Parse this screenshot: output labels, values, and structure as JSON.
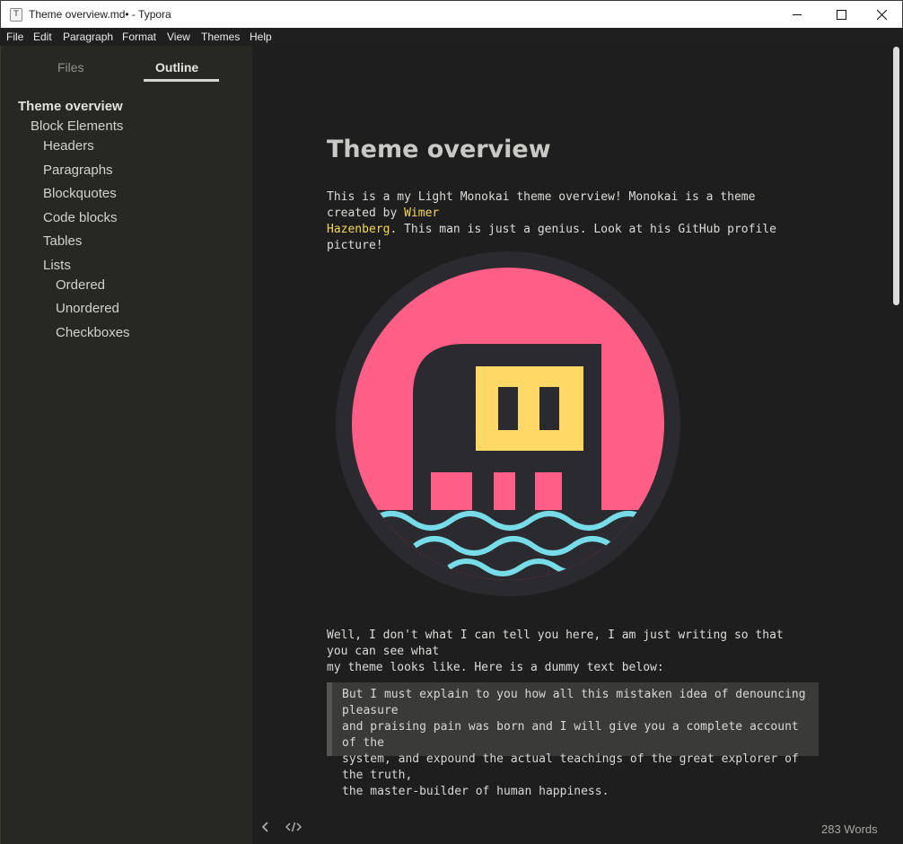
{
  "window": {
    "title": "Theme overview.md• - Typora",
    "app_icon_letter": "T"
  },
  "menu": {
    "items": [
      "File",
      "Edit",
      "Paragraph",
      "Format",
      "View",
      "Themes",
      "Help"
    ]
  },
  "sidebar": {
    "tabs": [
      {
        "label": "Files",
        "active": false
      },
      {
        "label": "Outline",
        "active": true
      }
    ],
    "outline": [
      {
        "label": "Theme overview",
        "level": 1
      },
      {
        "label": "Block Elements",
        "level": 2
      },
      {
        "label": "Headers",
        "level": 3
      },
      {
        "label": "Paragraphs",
        "level": 3
      },
      {
        "label": "Blockquotes",
        "level": 3
      },
      {
        "label": "Code blocks",
        "level": 3
      },
      {
        "label": "Tables",
        "level": 3
      },
      {
        "label": "Lists",
        "level": 3
      },
      {
        "label": "Ordered",
        "level": 4
      },
      {
        "label": "Unordered",
        "level": 4
      },
      {
        "label": "Checkboxes",
        "level": 4
      }
    ]
  },
  "document": {
    "title": "Theme overview",
    "intro": {
      "line1_before_link": "This is a my Light Monokai theme overview! Monokai is a theme created by ",
      "link_part1": "Wimer",
      "link_part2": "Hazenberg",
      "line2_after_link": ". This man is just a genius. Look at his GitHub profile picture!"
    },
    "paragraph2": {
      "line1": "Well, I don't what I can tell you here, I am just writing so that you can see what",
      "line2": "my theme looks like. Here is a dummy text below:"
    },
    "blockquote": {
      "lines": [
        "But I must explain to you how all this mistaken idea of denouncing pleasure",
        "and praising pain was born and I will give you a complete account of the",
        "system, and expound the actual teachings of the great explorer of the truth,",
        "the master-builder of human happiness."
      ]
    }
  },
  "footer": {
    "word_count": "283 Words"
  },
  "colors": {
    "sidebar_bg": "#272822",
    "editor_bg": "#1e1e1f",
    "link": "#f3d659",
    "avatar_pink": "#ff5f87",
    "avatar_yellow": "#ffd866",
    "avatar_wave": "#78dce8",
    "avatar_dark": "#2b2a2e"
  }
}
